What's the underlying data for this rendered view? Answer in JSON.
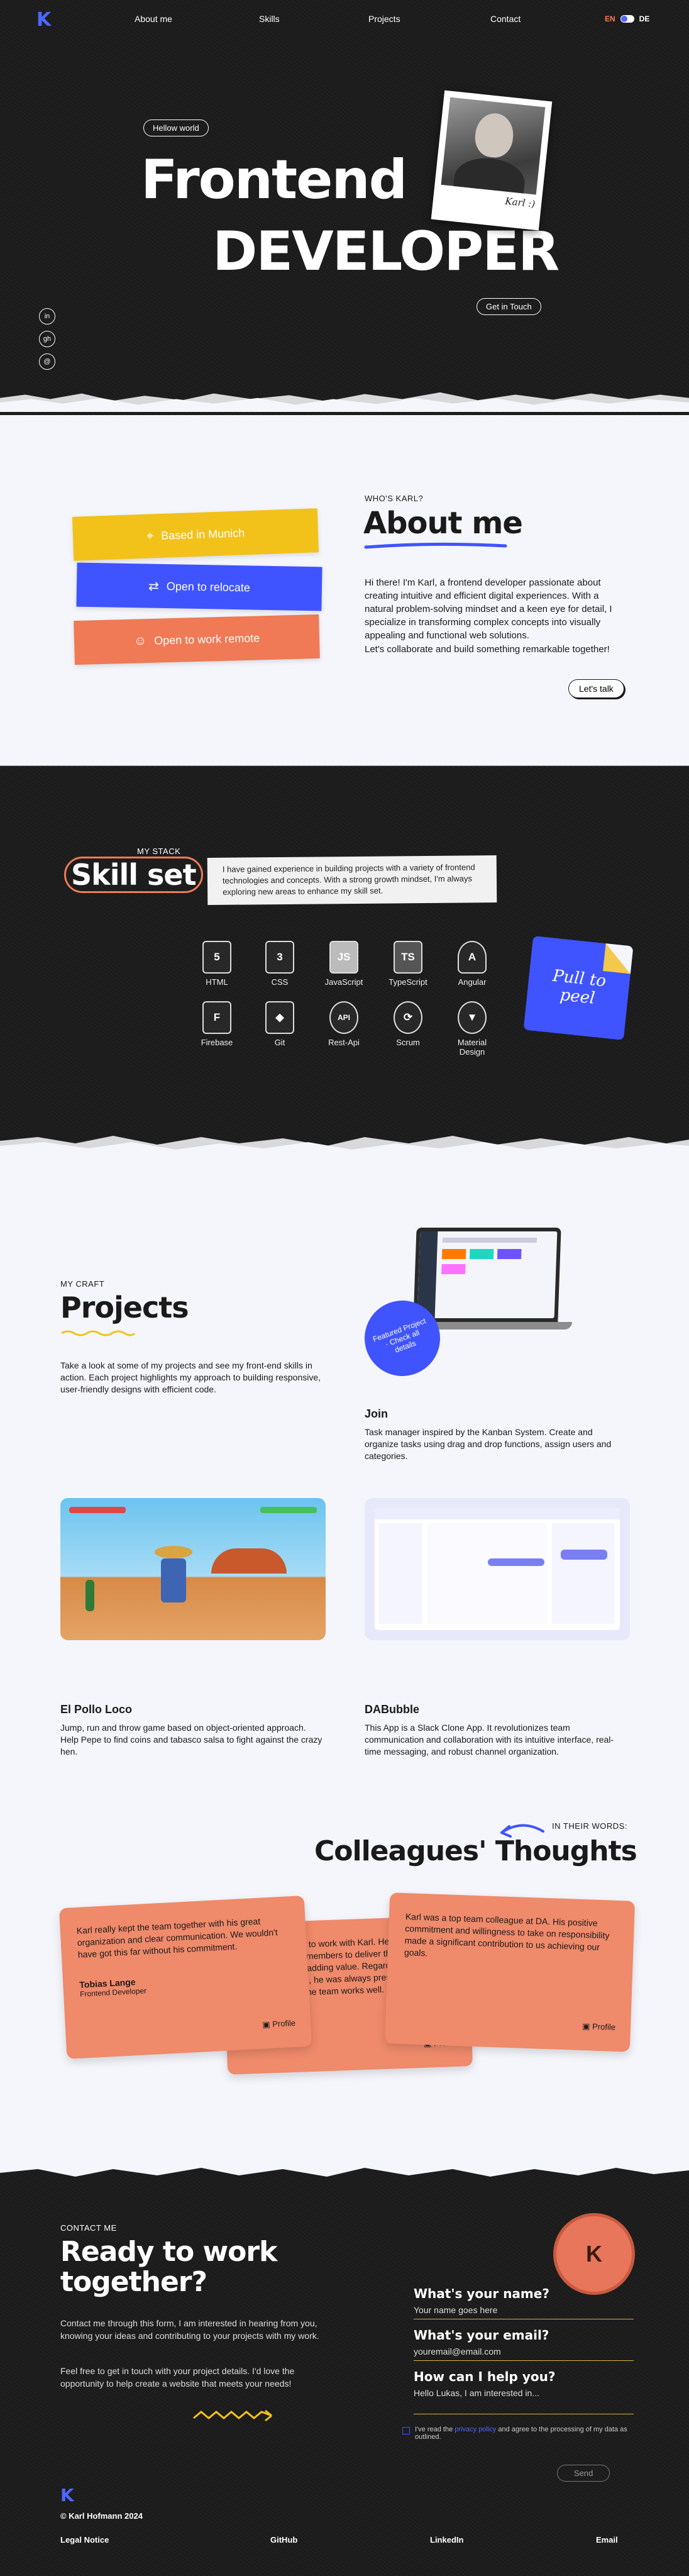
{
  "nav": {
    "logo": "K",
    "items": [
      "About me",
      "Skills",
      "Projects",
      "Contact"
    ],
    "lang_en": "EN",
    "lang_de": "DE"
  },
  "hero": {
    "greeting": "Hellow world",
    "title1": "Frontend",
    "title2": "DEVELOPER",
    "photo_caption": "Karl :)",
    "cta": "Get in Touch",
    "social": [
      "in",
      "gh",
      "@"
    ]
  },
  "about": {
    "kicker": "WHO'S KARL?",
    "title": "About me",
    "stickers": [
      "Based in Munich",
      "Open to relocate",
      "Open to work remote"
    ],
    "para1": "Hi there! I'm Karl, a frontend developer passionate about creating intuitive and efficient digital experiences. With a natural problem-solving mindset and a keen eye for detail, I specialize in transforming complex concepts into visually appealing and functional web solutions.",
    "para2": "Let's collaborate and build something remarkable together!",
    "cta": "Let's talk"
  },
  "skills": {
    "kicker": "MY STACK",
    "title": "Skill set",
    "intro": "I have gained experience in building projects with a variety of frontend technologies and concepts. With a strong growth mindset, I'm always exploring new areas to enhance my skill set.",
    "items": [
      {
        "label": "HTML",
        "icon": "5"
      },
      {
        "label": "CSS",
        "icon": "3"
      },
      {
        "label": "JavaScript",
        "icon": "JS"
      },
      {
        "label": "TypeScript",
        "icon": "TS"
      },
      {
        "label": "Angular",
        "icon": "A"
      },
      {
        "label": "Firebase",
        "icon": "F"
      },
      {
        "label": "Git",
        "icon": "◆"
      },
      {
        "label": "Rest-Api",
        "icon": "API"
      },
      {
        "label": "Scrum",
        "icon": "⟳"
      },
      {
        "label": "Material Design",
        "icon": "▼"
      }
    ],
    "peel": "Pull to peel"
  },
  "projects": {
    "kicker": "MY CRAFT",
    "title": "Projects",
    "intro": "Take a look at some of my projects and see my front-end skills in action. Each project highlights my approach to building responsive, user-friendly designs with efficient code.",
    "badge": "Featured Project · Check all details",
    "list": [
      {
        "name": "Join",
        "desc": "Task manager inspired by the Kanban System. Create and organize tasks using drag and drop functions, assign users and categories."
      },
      {
        "name": "El Pollo Loco",
        "desc": "Jump, run and throw game based on object-oriented approach. Help Pepe to find coins and tabasco salsa to fight against the crazy hen."
      },
      {
        "name": "DABubble",
        "desc": "This App is a Slack Clone App. It revolutionizes team communication and collaboration with its intuitive interface, real-time messaging, and robust channel organization."
      }
    ]
  },
  "thoughts": {
    "kicker": "IN THEIR WORDS:",
    "title": "Colleagues' Thoughts",
    "cards": [
      {
        "text": "Karl really kept the team together with his great organization and clear communication. We wouldn't have got this far without his commitment.",
        "name": "Tobias Lange",
        "role": "Frontend Developer",
        "profile": "Profile"
      },
      {
        "text": "It was a pleasure to work with Karl. He knows how to encourage team members to deliver their work possible, always adding value. Regarding the well-being of the team, he was always present and helpful, and so ensured the team works well.",
        "name": "",
        "role": "",
        "profile": "Profile"
      },
      {
        "text": "Karl was a top team colleague at DA. His positive commitment and willingness to take on responsibility made a significant contribution to us achieving our goals.",
        "name": "",
        "role": "",
        "profile": "Profile"
      }
    ]
  },
  "contact": {
    "kicker": "CONTACT ME",
    "title1": "Ready to work",
    "title2": "together?",
    "para1": "Contact me through this form, I am interested in hearing from you, knowing your ideas and contributing to your projects with my work.",
    "para2": "Feel free to get in touch with your project details. I'd love the opportunity to help create a website that meets your needs!",
    "fields": [
      {
        "label": "What's your name?",
        "placeholder": "Your name goes here"
      },
      {
        "label": "What's your email?",
        "placeholder": "youremail@email.com"
      },
      {
        "label": "How can I help you?",
        "placeholder": "Hello Lukas, I am interested in..."
      }
    ],
    "privacy_pre": "I've read the ",
    "privacy_link": "privacy policy",
    "privacy_post": " and agree to the processing of my data as outlined.",
    "send": "Send"
  },
  "footer": {
    "copyright": "© Karl Hofmann 2024",
    "links": [
      "Legal Notice",
      "GitHub",
      "LinkedIn",
      "Email"
    ]
  },
  "colors": {
    "accent": "#4e67ff",
    "yellow": "#f2c94c",
    "orange": "#ef8a6b",
    "dark": "#1c1c1c"
  }
}
